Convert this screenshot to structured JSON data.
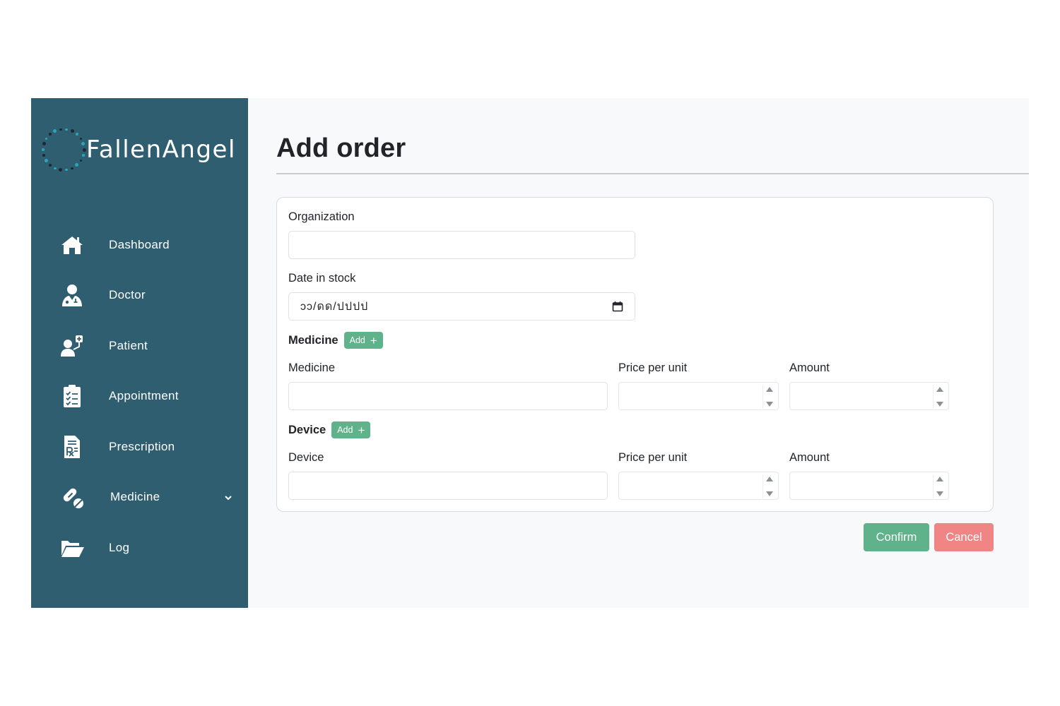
{
  "brand": {
    "name": "FallenAngel"
  },
  "sidebar": {
    "items": [
      {
        "label": "Dashboard",
        "icon": "home-icon"
      },
      {
        "label": "Doctor",
        "icon": "doctor-icon"
      },
      {
        "label": "Patient",
        "icon": "patient-icon"
      },
      {
        "label": "Appointment",
        "icon": "clipboard-check-icon"
      },
      {
        "label": "Prescription",
        "icon": "prescription-icon"
      },
      {
        "label": "Medicine",
        "icon": "pills-icon",
        "has_dropdown": true
      },
      {
        "label": "Log",
        "icon": "folder-open-icon"
      }
    ]
  },
  "page": {
    "title": "Add order"
  },
  "form": {
    "organization": {
      "label": "Organization",
      "value": ""
    },
    "date_in_stock": {
      "label": "Date in stock",
      "placeholder": "ɔɔ/ดด/ปปปป"
    },
    "medicine_section": {
      "title": "Medicine",
      "add_label": "Add",
      "col_name": "Medicine",
      "col_price": "Price per unit",
      "col_amount": "Amount"
    },
    "device_section": {
      "title": "Device",
      "add_label": "Add",
      "col_name": "Device",
      "col_price": "Price per unit",
      "col_amount": "Amount"
    }
  },
  "actions": {
    "confirm_label": "Confirm",
    "cancel_label": "Cancel"
  },
  "colors": {
    "sidebar": "#2f5e70",
    "accent_green": "#5fb28a",
    "cancel_red": "#f08585"
  }
}
